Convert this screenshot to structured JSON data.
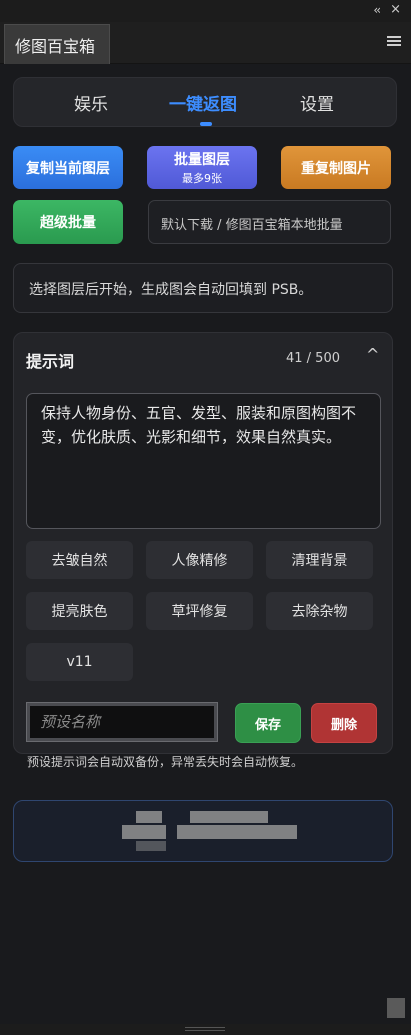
{
  "window": {
    "collapse_icon": "double-chevron-left-icon",
    "close_icon": "close-icon",
    "tab_title": "修图百宝箱",
    "menu_icon": "hamburger-menu-icon"
  },
  "nav": {
    "tabs": [
      {
        "label": "娱乐"
      },
      {
        "label": "一键返图"
      },
      {
        "label": "设置"
      }
    ],
    "active_color": "#3d8dff"
  },
  "actions": {
    "copy_layer": "复制当前图层",
    "batch_layer": "批量图层",
    "batch_limit": "最多9张",
    "recopy_image": "重复制图片",
    "super_batch": "超级批量",
    "download_path": "默认下载 / 修图百宝箱本地批量"
  },
  "hint": "选择图层后开始，生成图会自动回填到 PSB。",
  "prompt": {
    "title": "提示词",
    "count": "41 / 500",
    "text": "保持人物身份、五官、发型、服装和原图构图不变，优化肤质、光影和细节，效果自然真实。",
    "chips": [
      "去皱自然",
      "人像精修",
      "清理背景",
      "提亮肤色",
      "草坪修复",
      "去除杂物",
      "v11"
    ],
    "preset_placeholder": "预设名称",
    "save": "保存",
    "delete": "删除",
    "note": "预设提示词会自动双备份，异常丢失时会自动恢复。"
  },
  "colors": {
    "blue": "#2b6fdc",
    "purple": "#5059d6",
    "orange": "#c97a22",
    "green": "#2a9a4f",
    "save": "#2e8f45",
    "delete": "#b03434"
  }
}
